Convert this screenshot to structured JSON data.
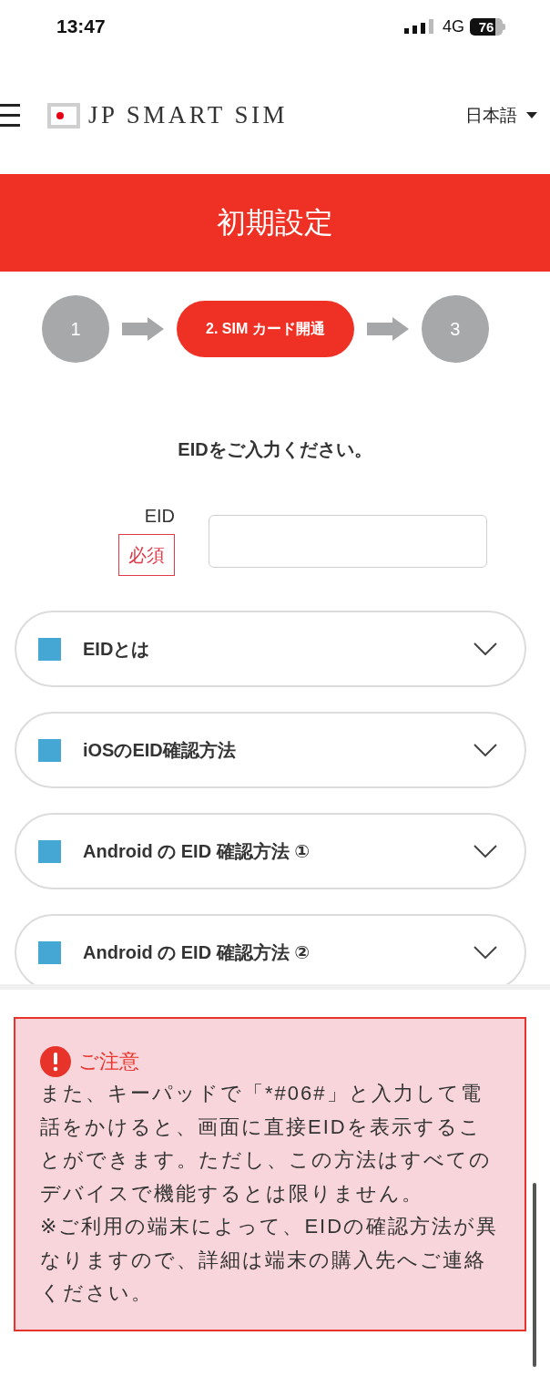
{
  "status_bar": {
    "time": "13:47",
    "network": "4G",
    "battery": "76"
  },
  "header": {
    "logo": "JP SMART SIM",
    "language": "日本語"
  },
  "banner": {
    "title": "初期設定"
  },
  "steps": [
    {
      "label": "1",
      "selected": false
    },
    {
      "label": "2. SIM カード開通",
      "selected": true
    },
    {
      "label": "3",
      "selected": false
    }
  ],
  "form": {
    "prompt": "EIDをご入力ください。",
    "field": {
      "label": "EID",
      "badge": "必須"
    }
  },
  "accordions": [
    {
      "title": "EIDとは",
      "expanded": false
    },
    {
      "title": "iOSのEID確認方法",
      "expanded": false
    },
    {
      "title": "Android の EID 確認方法 ①",
      "expanded": false
    },
    {
      "title": "Android の EID 確認方法 ②",
      "expanded": false
    }
  ],
  "notice": {
    "title": "ご注意",
    "paragraphs": [
      "また、キーパッドで「*#06#」と入力して電話をかけると、画面に直接EIDを表示することができます。ただし、この方法はすべてのデバイスで機能するとは限りません。",
      "※ご利用の端末によって、EIDの確認方法が異なりますので、詳細は端末の購入先へご連絡ください。"
    ]
  }
}
